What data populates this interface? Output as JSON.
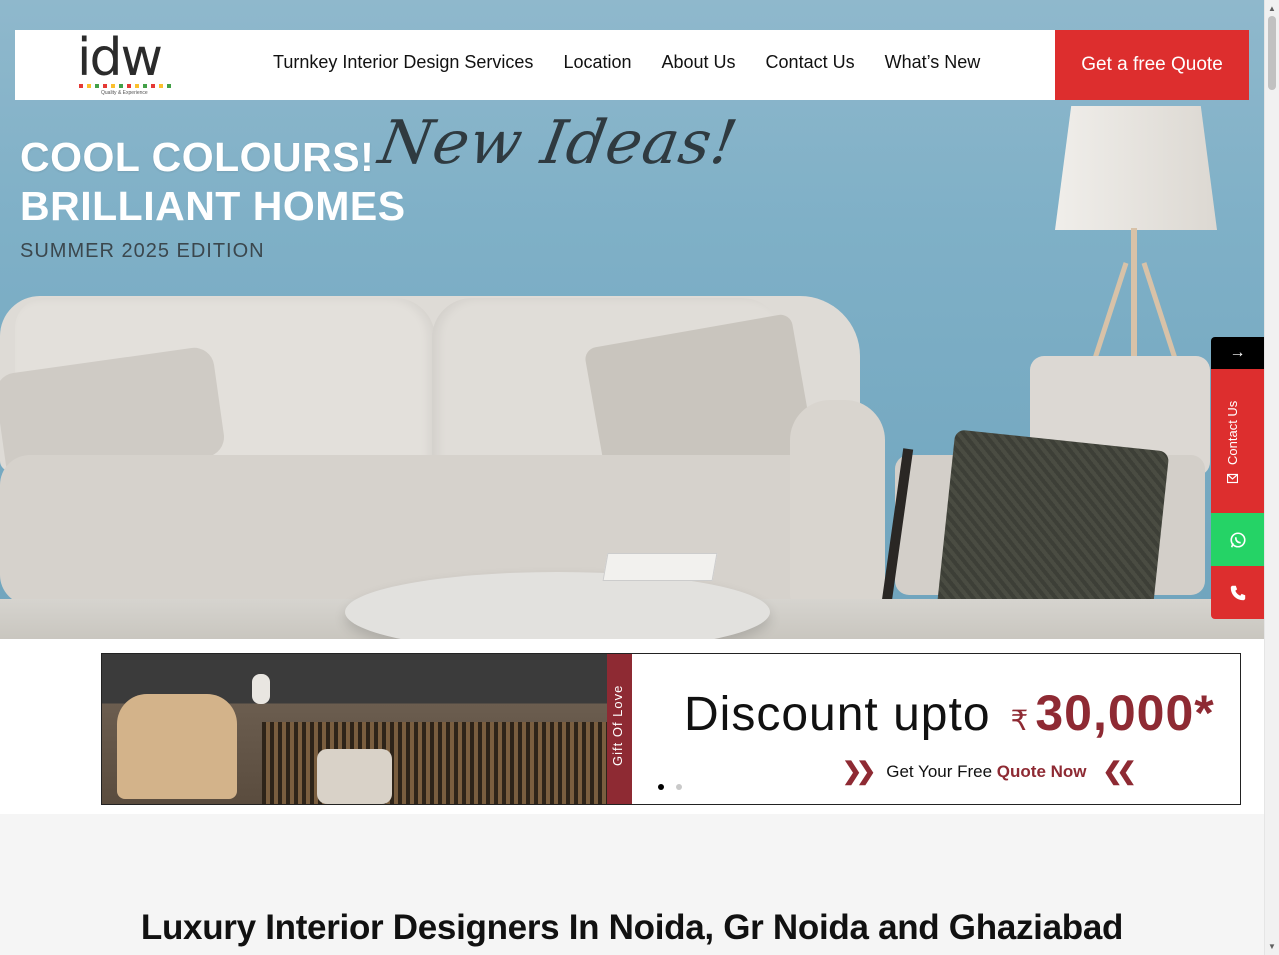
{
  "header": {
    "logo_text": "idw",
    "logo_tagline": "Quality & Experience",
    "nav": [
      {
        "label": "Turnkey Interior Design Services"
      },
      {
        "label": "Location"
      },
      {
        "label": "About Us"
      },
      {
        "label": "Contact Us"
      },
      {
        "label": "What’s New"
      }
    ],
    "cta_label": "Get a free Quote"
  },
  "hero": {
    "title_line1": "COOL COLOURS!",
    "title_script": "New Ideas!",
    "title_line2": "BRILLIANT HOMES",
    "edition": "SUMMER 2025 EDITION"
  },
  "floating": {
    "arrow": "→",
    "contact_label": "Contact Us",
    "contact_icon": "envelope-icon",
    "whatsapp_icon": "whatsapp-icon",
    "phone_icon": "phone-icon"
  },
  "promo": {
    "side_label": "Gift Of Love",
    "discount_text": "Discount upto",
    "currency": "₹",
    "amount": "30,000*",
    "cta_prefix": "Get Your Free",
    "cta_highlight": "Quote Now",
    "slide_count": 2,
    "active_slide": 1
  },
  "main": {
    "heading": "Luxury Interior Designers In Noida, Gr Noida and Ghaziabad"
  },
  "colors": {
    "accent_red": "#dd2e2e",
    "maroon": "#8e2a33",
    "whatsapp_green": "#25d366"
  }
}
